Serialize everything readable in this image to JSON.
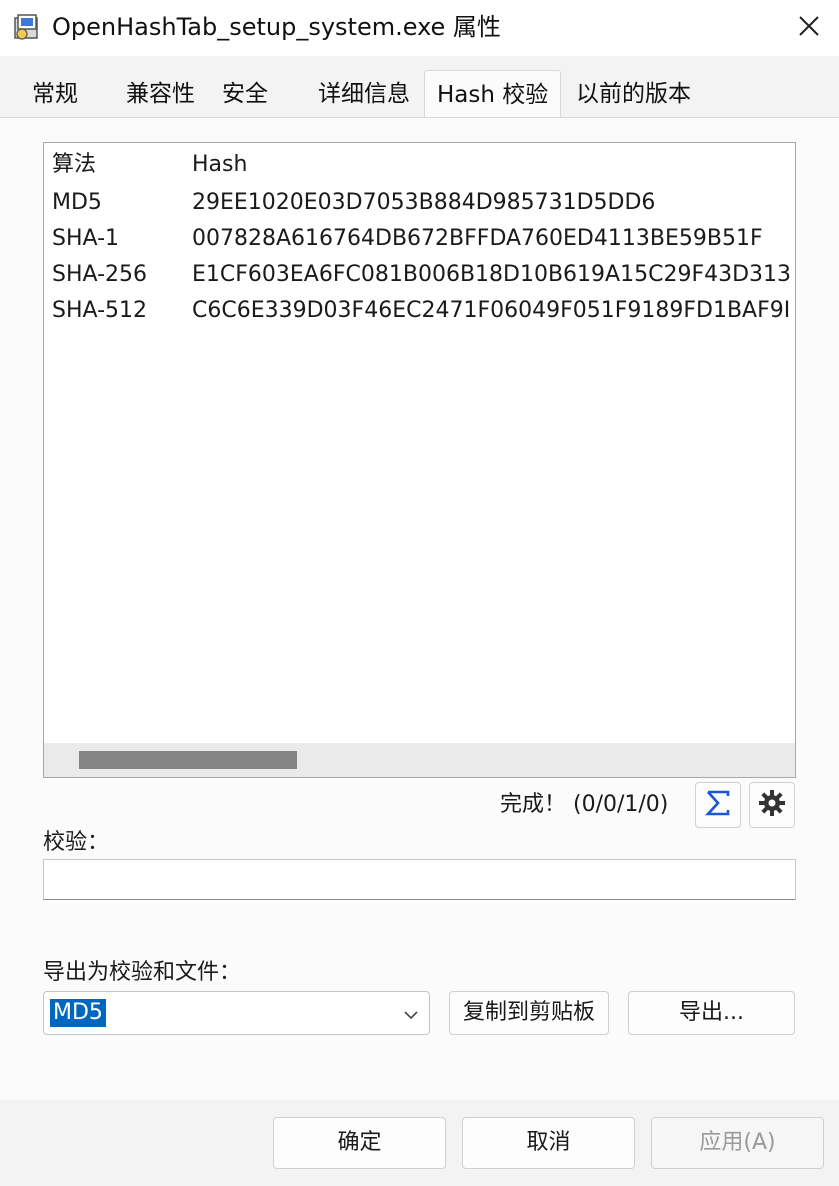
{
  "window": {
    "title": "OpenHashTab_setup_system.exe 属性"
  },
  "tabs": [
    {
      "label": "常规"
    },
    {
      "label": "兼容性"
    },
    {
      "label": "安全"
    },
    {
      "label": "详细信息"
    },
    {
      "label": "Hash 校验",
      "active": true
    },
    {
      "label": "以前的版本"
    }
  ],
  "hash_list": {
    "columns": [
      "算法",
      "Hash"
    ],
    "rows": [
      {
        "algorithm": "MD5",
        "hash": "29EE1020E03D7053B884D985731D5DD6"
      },
      {
        "algorithm": "SHA-1",
        "hash": "007828A616764DB672BFFDA760ED4113BE59B51F"
      },
      {
        "algorithm": "SHA-256",
        "hash": "E1CF603EA6FC081B006B18D10B619A15C29F43D313"
      },
      {
        "algorithm": "SHA-512",
        "hash": "C6C6E339D03F46EC2471F06049F051F9189FD1BAF9I"
      }
    ]
  },
  "status": {
    "text": "完成！ (0/0/1/0)"
  },
  "icons": {
    "sum": "sigma-icon",
    "settings": "gear-icon",
    "close": "close-icon",
    "dropdown": "chevron-down-icon"
  },
  "verify": {
    "label": "校验：",
    "value": ""
  },
  "export": {
    "label": "导出为校验和文件：",
    "selected_algorithm": "MD5",
    "copy_label": "复制到剪贴板",
    "export_label": "导出..."
  },
  "dialog_buttons": {
    "ok": "确定",
    "cancel": "取消",
    "apply": "应用(A)"
  },
  "colors": {
    "accent": "#0067c0",
    "sigma": "#1a56d6"
  }
}
